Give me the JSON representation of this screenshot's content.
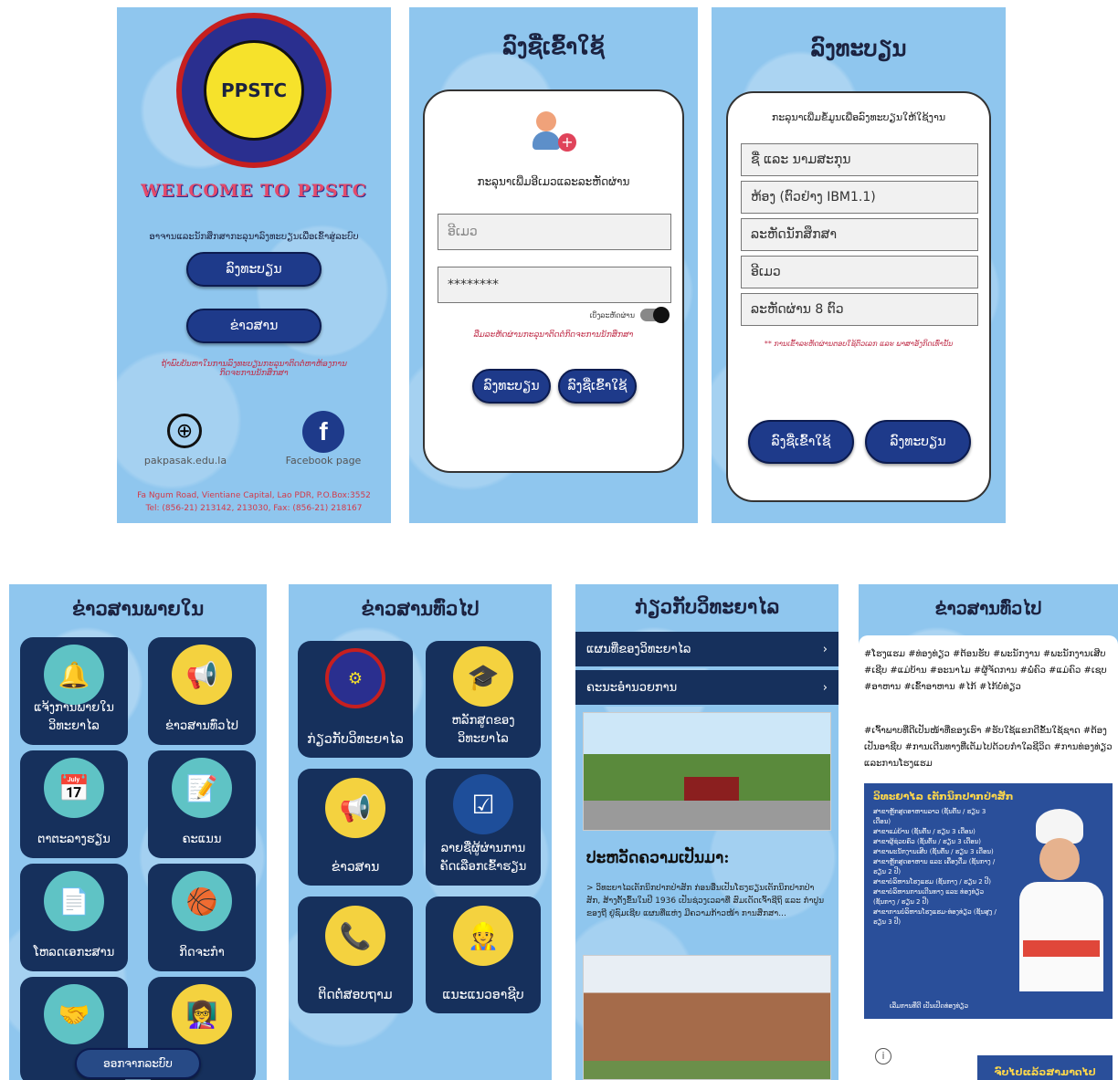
{
  "s1": {
    "logo_text": "PPSTC",
    "welcome": "WELCOME TO PPSTC",
    "instruction": "ອາຈານແລະນັກສຶກສາກະລຸນາລົງທະບຽນເພື່ອເຂົ້າສູ່ລະບົບ",
    "register_btn": "ລົງທະບຽນ",
    "news_btn": "ຂ່າວສານ",
    "help_text": "ຖ້າພົບບັນຫາໃນການລົງທະບຽນກະລຸນາຕິດຕໍ່ຫາຫ້ອງການກິດຈະການນັກສຶກສາ",
    "website_label": "pakpasak.edu.la",
    "facebook_label": "Facebook page",
    "address": "Fa Ngum Road, Vientiane Capital, Lao PDR, P.O.Box:3552",
    "phone": "Tel: (856-21) 213142, 213030, Fax: (856-21) 218167"
  },
  "s2": {
    "title": "ລົງຊື່ເຂົ້າໃຊ້",
    "prompt": "ກະລຸນາເພີ່ມອີເມວແລະລະຫັດຜ່ານ",
    "email_placeholder": "ອີເມວ",
    "password_value": "********",
    "show_password": "ເບິ່ງລະຫັດຜ່ານ",
    "forgot_text": "ລືມລະຫັດຜ່ານກະລຸນາຕິດຕໍ່ກິດຈະການນັກສຶກສາ",
    "register_btn": "ລົງທະບຽນ",
    "login_btn": "ລົງຊື່ເຂົ້າໃຊ້"
  },
  "s3": {
    "title": "ລົງທະບຽນ",
    "prompt": "ກະລຸນາເພີ່ມຂໍ້ມູນເພື່ອລົງທະບຽນໃຫ້ໃຊ້ງານ",
    "fields": [
      "ຊື່ ແລະ ນາມສະກຸນ",
      "ຫ້ອງ (ຕົວຢ່າງ IBM1.1)",
      "ລະຫັດນັກສຶກສາ",
      "ອີເມວ",
      "ລະຫັດຜ່ານ 8 ຕົວ"
    ],
    "note": "** ການເຂົ້າລະຫັດຜ່ານຕອບໃຊ້ຕົວເລກ ແລະ ພາສາອັງກິດເທົ່ານັ້ນ",
    "login_btn": "ລົງຊື່ເຂົ້າໃຊ້",
    "register_btn": "ລົງທະບຽນ"
  },
  "s4": {
    "title": "ຂ່າວສານພາຍໃນ",
    "tiles": [
      "ແຈ້ງການພາຍໃນວິທະຍາໄລ",
      "ຂ່າວສານທົ່ວໄປ",
      "ຕາຕະລາງຮຽນ",
      "ຄະແນນ",
      "ໂຫລດເອກະສານ",
      "ກິດຈະກໍາ",
      "",
      ""
    ],
    "logout_btn": "ອອກຈາກລະບົບ"
  },
  "s5": {
    "title": "ຂ່າວສານທົ່ວໄປ",
    "tiles": [
      "ກ່ຽວກັບວິທະຍາໄລ",
      "ຫລັກສູດຂອງວິທະຍາໄລ",
      "ຂ່າວສານ",
      "ລາຍຊື່ຜູ້ຜ່ານການຄັດເລືອກເຂົ້າຮຽນ",
      "ຕິດຕໍ່ສອບຖາມ",
      "ແນະແນວອາຊີບ"
    ]
  },
  "s6": {
    "title": "ກ່ຽວກັບວິທະຍາໄລ",
    "menu": [
      "ແຜນທີ່ຂອງວິທະຍາໄລ",
      "ຄະນະອໍານວຍການ"
    ],
    "history_heading": "ປະຫວັດຄວາມເປັນມາ:",
    "history_text": "> ວິທະຍາໄລເຕັກນິກປາກປ່າສັກ ກ່ອນອື່ນເປັນໂຮງຮຽນເຕັກນິກປາກປ່າສັກ, ສ້າງຕັ້ງຂຶ້ນໃນປີ 1936 ເປັນຊ່ວງເວລາທີ່ ສົມເດັດເຈົ້າຊີຖິ ແລະ ກໍາປູນຂອງຖີ ຢູ່ຊົມເຊີຍ ແຜນທີ່ແຫ່ງ ມີຄວາມກ້າວໜ້າ ການສຶກສາ..."
  },
  "s7": {
    "title": "ຂ່າວສານທົ່ວໄປ",
    "hashtags_1": "#ໂຮງແຮມ #ທ່ອງທ່ຽວ #ຕ້ອນຮັບ #ພະນັກງານ #ພະນັກງານເສີບ #ເຊີບ #ແມ່ບ້ານ #ອະນາໄມ #ຜູ້ຈັດການ #ພໍ່ຄົວ #ແມ່ຄົວ #ເຊບ #ອາຫານ #ເຂົ້າອາຫານ #ໄກ້ #ໄກ້ບໍ່ທ່ຽວ",
    "hashtags_2": "#ເຈົ້າພາບທີ່ດີເປັນໜ້າທີ່ຂອງເຮົາ #ຮັບໃຊ້ແຂກດີຂັ້ນໃຊ້ຊາດ #ຕ້ອງເປັນອາຊີບ #ການເດີນທາງທີ່ເຕັມໄປດ້ວຍກໍາໃລຊີວິດ #ການທ່ອງທ່ຽວແລະການໂຮງແຮມ",
    "poster_title": "ວິທະຍາໄລ ເຕັກນິກປາກປ່າສັກ",
    "poster_items": [
      "ສາຂາຫຼັກສູດອາຫານລາວ (ຊັ້ນຕົ້ນ / ຮຽນ 3 ເດືອນ)",
      "ສາຂາແມ່ບ້ານ (ຊັ້ນຕົ້ນ / ຮຽນ 3 ເດືອນ)",
      "ສາຂາຜູ້ຊ່ວຍຄົວ (ຊັ້ນຕົ້ນ / ຮຽນ 3 ເດືອນ)",
      "ສາຂາພະນັກງານເສີບ (ຊັ້ນຕົ້ນ / ຮຽນ 3 ເດືອນ)",
      "ສາຂາຫຼັກສູດອາຫານ ແລະ ເຄື່ອງດື່ມ (ຊັ້ນກາງ / ຮຽນ 2 ປີ)",
      "ສາຂາບໍລິຫານໂຮງແຮມ (ຊັ້ນກາງ / ຮຽນ 2 ປີ)",
      "ສາຂາບໍລິຫານການເດີນທາງ ແລະ ທ່ອງທ່ຽວ (ຊັ້ນກາງ / ຮຽນ 2 ປີ)",
      "ສາຂາການບໍລິຫານໂຮງແຮມ-ທ່ອງທ່ຽວ (ຊັ້ນສູງ / ຮຽນ 3 ປີ)"
    ],
    "poster_footer": "ເລີ່ມການທີ່ດີ ເປັນເປີດທ່ອງທ່ຽວ",
    "bottom_banner": "ຈົບໄປແລ້ວສາມາດໄປ"
  }
}
